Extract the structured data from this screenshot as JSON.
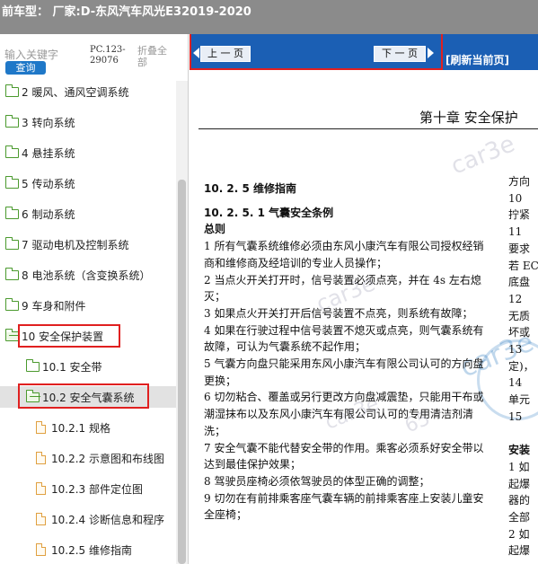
{
  "titlebar": {
    "text": "前车型：  厂家:D-东风汽车风光E32019-2020"
  },
  "sidebar": {
    "search_placeholder": "输入关键字",
    "query_label": "查询",
    "pc_code": "PC.123-29076",
    "collapse_all": "折叠全部",
    "items": [
      {
        "label": "2 暖风、通风空调系统"
      },
      {
        "label": "3 转向系统"
      },
      {
        "label": "4 悬挂系统"
      },
      {
        "label": "5 传动系统"
      },
      {
        "label": "6 制动系统"
      },
      {
        "label": "7 驱动电机及控制系统"
      },
      {
        "label": "8 电池系统（含变换系统）"
      },
      {
        "label": "9 车身和附件"
      },
      {
        "label": "10 安全保护装置"
      },
      {
        "label": "10.1 安全带"
      },
      {
        "label": "10.2 安全气囊系统"
      },
      {
        "label": "10.2.1 规格"
      },
      {
        "label": "10.2.2 示意图和布线图"
      },
      {
        "label": "10.2.3 部件定位图"
      },
      {
        "label": "10.2.4 诊断信息和程序"
      },
      {
        "label": "10.2.5 维修指南"
      }
    ]
  },
  "content": {
    "prev_label": "上 一 页",
    "next_label": "下 一 页",
    "refresh_label": "[刷新当前页]",
    "chapter_title": "第十章  安全保护",
    "section": "10. 2. 5  维修指南",
    "subsection": "10. 2. 5. 1 气囊安全条例",
    "general": "总则",
    "paragraphs": [
      "1    所有气囊系统维修必须由东风小康汽车有限公司授权经销商和维修商及经培训的专业人员操作；",
      "2    当点火开关打开时，信号装置必须点亮，并在 4s 左右熄灭；",
      "3    如果点火开关打开后信号装置不点亮，则系统有故障；",
      "4    如果在行驶过程中信号装置不熄灭或点亮，则气囊系统有故障，可认为气囊系统不起作用；",
      "5    气囊方向盘只能采用东风小康汽车有限公司认可的方向盘更换；",
      "6    切勿粘合、覆盖或另行更改方向盘减震垫，只能用干布或潮湿抹布以及东风小康汽车有限公司认可的专用清洁剂清洗；",
      "7    安全气囊不能代替安全带的作用。乘客必须系好安全带以达到最佳保护效果；",
      "8    驾驶员座椅必须依驾驶员的体型正确的调整；",
      "9    切勿在有前排乘客座气囊车辆的前排乘客座上安装儿童安全座椅；"
    ],
    "side_lines": [
      "方向",
      "10  ",
      "拧紧",
      "11  ",
      "要求",
      "若 EC",
      "底盘",
      "12  ",
      "无质",
      "坏或",
      "13  ",
      "定)，",
      "14  ",
      "单元",
      "15  ",
      "",
      "安装",
      "1  如",
      "起爆",
      "器的",
      "全部",
      "2  如",
      "起爆"
    ],
    "watermark_1": "car3e",
    "watermark_2": "car3e",
    "watermark_3": "car3e",
    "watermark_4": "car3e",
    "watermark_num": "65"
  }
}
